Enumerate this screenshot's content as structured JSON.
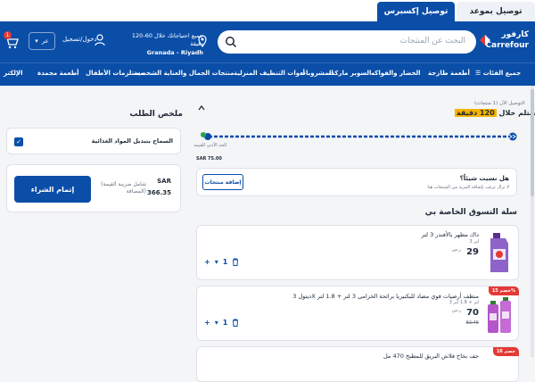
{
  "tabs": {
    "active": "توصيل إكسبرس",
    "inactive": "توصيل بموعد"
  },
  "header": {
    "logo_ar": "كارفور",
    "logo_en": "Carrefour",
    "search_placeholder": "البحث عن المنتجات",
    "delivery_line1": "جميع احتياجاتك خلال 60-120 دقيقة",
    "delivery_line2": "Granada - Riyadh",
    "login_label": "دخول/تسجيل",
    "lang_label": "عر",
    "cart_count": "1",
    "brand_color": "#0a4ea8"
  },
  "nav": {
    "items": [
      "جميع الفئات",
      "أطعمة طازجة",
      "الخضار والفواكه",
      "السوبر ماركت",
      "المشروبات",
      "أدوات التنظيف المنزلية",
      "منتجات الجمال والعناية الشخصية",
      "مستلزمات الأطفال",
      "أطعمة مجمدة",
      "الإلكتر"
    ]
  },
  "summary": {
    "title": "ملخص الطلب",
    "substitute_label": "السماح بتبديل المواد الغذائية",
    "checkout_label": "إتمام الشراء",
    "currency": "SAR",
    "total": "366.35",
    "vat_note": "(شامل ضريبة القيمة المضافة)"
  },
  "delivery": {
    "small": "التوصيل الآن (1 منتجات)",
    "main_prefix": "استلم خلال",
    "main_time": "120 دقيقة",
    "min_label": "الحد الأدنى للقيمة",
    "min_value": "SAR 75.00",
    "progress": 1.0
  },
  "forgot": {
    "title": "هل نسيت شيئاً؟",
    "subtitle": "لا تزال ترغب بإضافة المزيد من المنتجات هنا",
    "add_label": "إضافة منتجات"
  },
  "basket": {
    "title": "سلة التسوق الخاصة بي",
    "items": [
      {
        "name": "داك مطهر بالأفندر 3 لتر",
        "size": "3 لتر",
        "price": "29",
        "unit": "ر.س",
        "old": "",
        "discount": "",
        "qty": "1"
      },
      {
        "name": "ديتول 3X منظف أرضيات قوي مضاد للبكتيريا برائحة الخزامى 3 لتر + 1.8 لتر",
        "size": "3 لتر + 1.8 لتر",
        "price": "70",
        "unit": "ر.س",
        "old": "82.45",
        "discount": "خصم 15%",
        "qty": "1"
      },
      {
        "name": "جف بخاخ فلاش البريق للمطبخ 470 مل",
        "size": "",
        "price": "",
        "unit": "",
        "old": "",
        "discount": "خصم 16",
        "qty": ""
      }
    ]
  }
}
